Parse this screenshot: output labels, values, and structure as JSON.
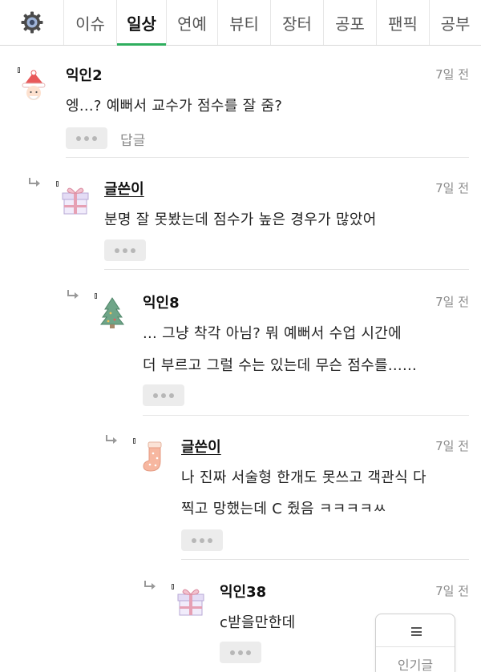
{
  "tabs": [
    {
      "label": "이슈",
      "active": false
    },
    {
      "label": "일상",
      "active": true
    },
    {
      "label": "연예",
      "active": false
    },
    {
      "label": "뷰티",
      "active": false
    },
    {
      "label": "장터",
      "active": false
    },
    {
      "label": "공포",
      "active": false
    },
    {
      "label": "팬픽",
      "active": false
    },
    {
      "label": "공부",
      "active": false
    }
  ],
  "settings_icon": "gear-icon",
  "comments": [
    {
      "author": "익인2",
      "avatar": "santa-avatar-icon",
      "time": "7일 전",
      "lines": [
        "엥...? 예뻐서 교수가 점수를 잘 줌?"
      ],
      "reply_label": "답글"
    },
    {
      "author": "글쓴이",
      "avatar": "gift-box-avatar-icon",
      "time": "7일 전",
      "lines": [
        "분명 잘 못봤는데 점수가 높은 경우가 많았어"
      ]
    },
    {
      "author": "익인8",
      "avatar": "christmas-tree-avatar-icon",
      "time": "7일 전",
      "lines": [
        "... 그냥 착각 아님? 뭐 예뻐서 수업 시간에",
        "더 부르고 그럴 수는 있는데 무슨 점수를......"
      ]
    },
    {
      "author": "글쓴이",
      "avatar": "stocking-avatar-icon",
      "time": "7일 전",
      "lines": [
        "나 진짜 서술형 한개도 못쓰고 객관식 다",
        "찍고 망했는데 C 줬음 ㅋㅋㅋㅋㅆ"
      ]
    },
    {
      "author": "익인38",
      "avatar": "gift-box-avatar-icon",
      "time": "7일 전",
      "lines": [
        "c받을만한데"
      ]
    }
  ],
  "popular_button": {
    "icon": "menu-icon",
    "label": "인기글"
  },
  "colors": {
    "accent": "#2fae5e",
    "time_text": "#8a8a8a",
    "more_button_bg": "#ececec"
  }
}
